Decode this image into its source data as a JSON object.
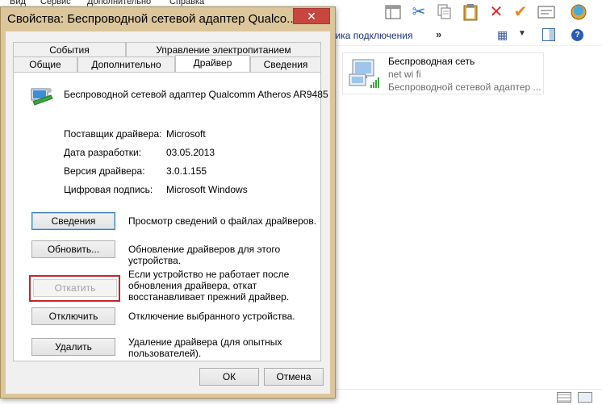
{
  "background": {
    "menubar": [
      "Вид",
      "Сервис",
      "Дополнительно",
      "Справка"
    ],
    "address": {
      "crumb": "тика подключения",
      "chevron": "»"
    },
    "network_tile": {
      "name": "Беспроводная сеть",
      "ssid": "net wi fi",
      "adapter": "Беспроводной сетевой адаптер ..."
    }
  },
  "dialog": {
    "title": "Свойства: Беспроводной сетевой адаптер Qualco...",
    "close_glyph": "✕",
    "tabs_row1": [
      {
        "label": "События"
      },
      {
        "label": "Управление электропитанием"
      }
    ],
    "tabs_row2": [
      {
        "label": "Общие"
      },
      {
        "label": "Дополнительно"
      },
      {
        "label": "Драйвер"
      },
      {
        "label": "Сведения"
      }
    ],
    "active_tab": "Драйвер",
    "device_name": "Беспроводной сетевой адаптер Qualcomm Atheros AR9485",
    "properties": [
      {
        "label": "Поставщик драйвера:",
        "value": "Microsoft"
      },
      {
        "label": "Дата разработки:",
        "value": "03.05.2013"
      },
      {
        "label": "Версия драйвера:",
        "value": "3.0.1.155"
      },
      {
        "label": "Цифровая подпись:",
        "value": "Microsoft Windows"
      }
    ],
    "actions": [
      {
        "label": "Сведения",
        "description": "Просмотр сведений о файлах драйверов.",
        "enabled": true
      },
      {
        "label": "Обновить...",
        "description": "Обновление драйверов для этого устройства.",
        "enabled": true
      },
      {
        "label": "Откатить",
        "description": "Если устройство не работает после обновления драйвера, откат восстанавливает прежний драйвер.",
        "enabled": false
      },
      {
        "label": "Отключить",
        "description": "Отключение выбранного устройства.",
        "enabled": true
      },
      {
        "label": "Удалить",
        "description": "Удаление драйвера (для опытных пользователей).",
        "enabled": true
      }
    ],
    "ok_label": "ОК",
    "cancel_label": "Отмена"
  },
  "colors": {
    "dialog_frame": "#dcc69b",
    "close_button": "#c7463f",
    "highlight_box": "#c0282d",
    "link_text": "#1e3287"
  }
}
